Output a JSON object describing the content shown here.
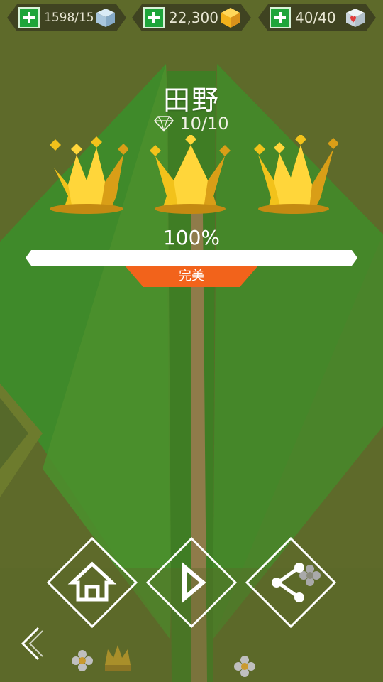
{
  "resources": [
    {
      "value": "1598/15",
      "icon": "cube-icon",
      "color": "#a9c7dd"
    },
    {
      "value": "22,300",
      "icon": "gold-gem-icon",
      "color": "#f2b21b"
    },
    {
      "value": "40/40",
      "icon": "heart-cube-icon",
      "color": "#e23b3b"
    }
  ],
  "level": {
    "title": "田野",
    "gems": "10/10",
    "crowns_earned": 3,
    "crowns_total": 3,
    "percent_label": "100%",
    "progress": 1.0,
    "rank": "完美"
  },
  "buttons": {
    "home": "home-icon",
    "play": "play-icon",
    "share": "share-icon",
    "back": "back-chevron-icon"
  },
  "colors": {
    "accent": "#f2631b",
    "plus": "#1ea53a",
    "crown": "#f2c21b"
  }
}
